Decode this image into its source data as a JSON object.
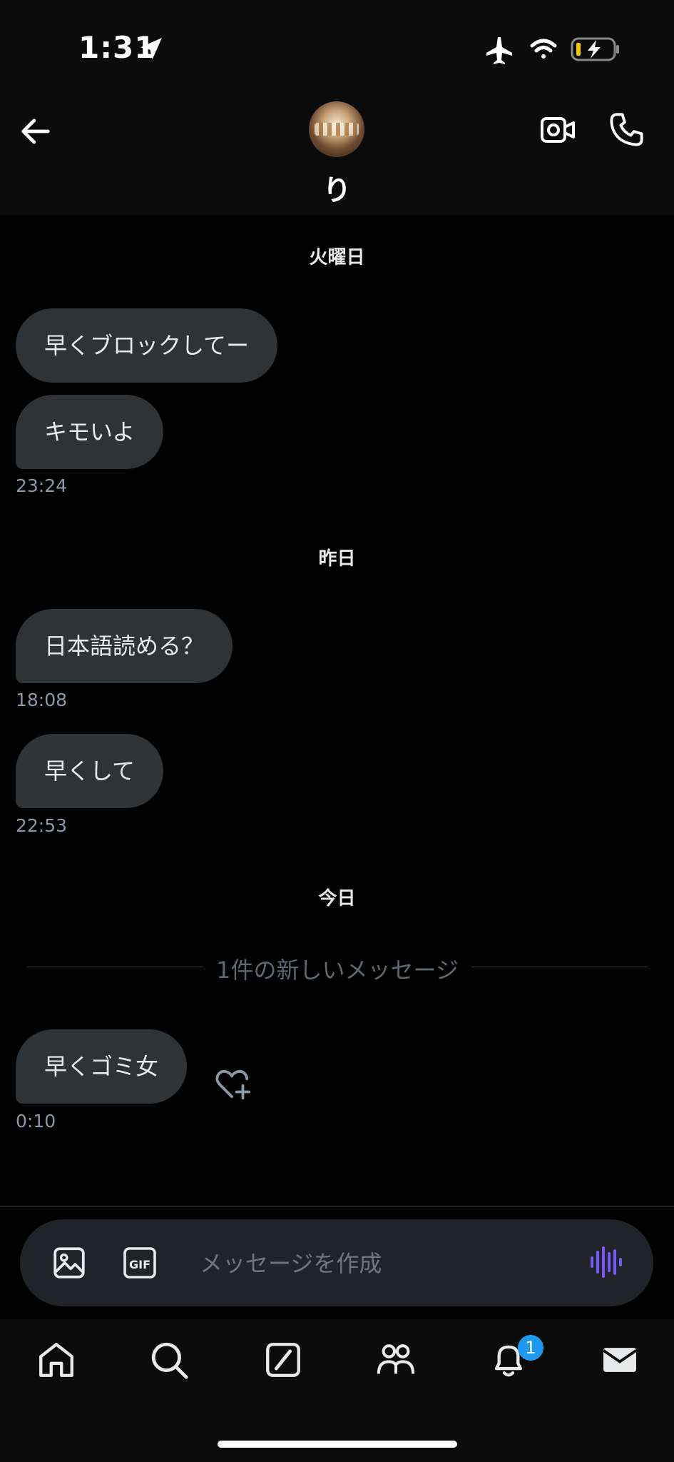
{
  "status_bar": {
    "time": "1:31"
  },
  "header": {
    "contact_name": "り"
  },
  "days": [
    {
      "label": "火曜日"
    },
    {
      "label": "昨日"
    },
    {
      "label": "今日"
    }
  ],
  "messages": [
    {
      "text": "早くブロックしてー"
    },
    {
      "text": "キモいよ",
      "time": "23:24"
    },
    {
      "text": "日本語読める？",
      "time": "18:08"
    },
    {
      "text": "早くして",
      "time": "22:53"
    },
    {
      "text": "早くゴミ女",
      "time": "0:10"
    }
  ],
  "new_messages_divider": "1件の新しいメッセージ",
  "composer": {
    "placeholder": "メッセージを作成"
  },
  "nav": {
    "notifications_badge": "1"
  },
  "colors": {
    "bubble": "#2f3336",
    "accent": "#7856ff",
    "badge": "#1d9bf0"
  }
}
